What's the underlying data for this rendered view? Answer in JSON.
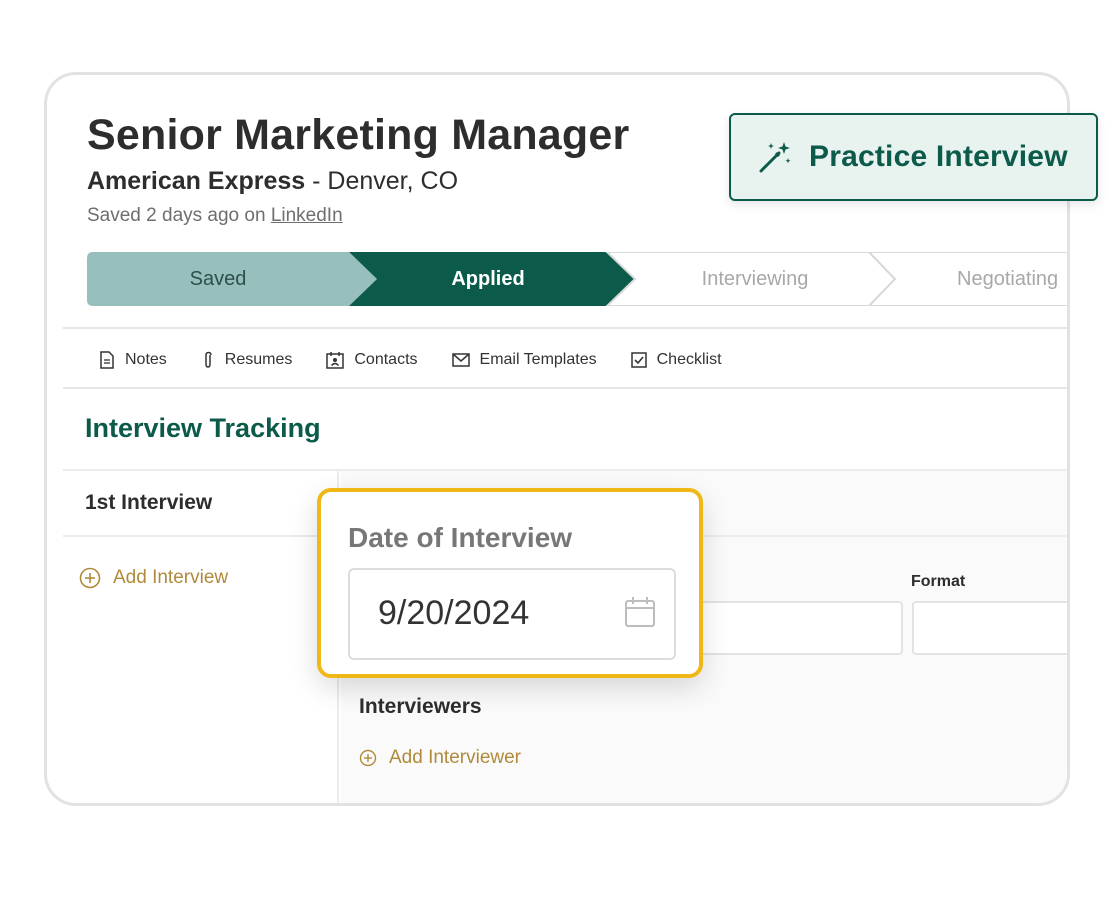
{
  "job": {
    "title": "Senior Marketing Manager",
    "company": "American Express",
    "separator": " - ",
    "location": "Denver, CO",
    "saved_prefix": "Saved 2 days ago on ",
    "saved_source": "LinkedIn"
  },
  "practice_button": {
    "label": "Practice Interview",
    "icon": "magic-wand-icon"
  },
  "pipeline": {
    "stages": [
      {
        "label": "Saved",
        "state": "completed"
      },
      {
        "label": "Applied",
        "state": "current"
      },
      {
        "label": "Interviewing",
        "state": "upcoming"
      },
      {
        "label": "Negotiating",
        "state": "upcoming"
      }
    ]
  },
  "tabs": [
    {
      "label": "Notes",
      "icon": "document-icon"
    },
    {
      "label": "Resumes",
      "icon": "paperclip-icon"
    },
    {
      "label": "Contacts",
      "icon": "contact-card-icon"
    },
    {
      "label": "Email Templates",
      "icon": "envelope-icon"
    },
    {
      "label": "Checklist",
      "icon": "checkbox-icon"
    }
  ],
  "section": {
    "title": "Interview Tracking"
  },
  "rounds": {
    "current": "1st Interview",
    "add_label": "Add Interview"
  },
  "form": {
    "format_label": "Format",
    "interviewers_label": "Interviewers",
    "add_interviewer_label": "Add Interviewer"
  },
  "date_popup": {
    "label": "Date of Interview",
    "value": "9/20/2024",
    "icon": "calendar-icon"
  },
  "colors": {
    "brand": "#0b5a4a",
    "saved_stage": "#97bfbd",
    "highlight": "#efb817",
    "add_link": "#b08a3a"
  }
}
